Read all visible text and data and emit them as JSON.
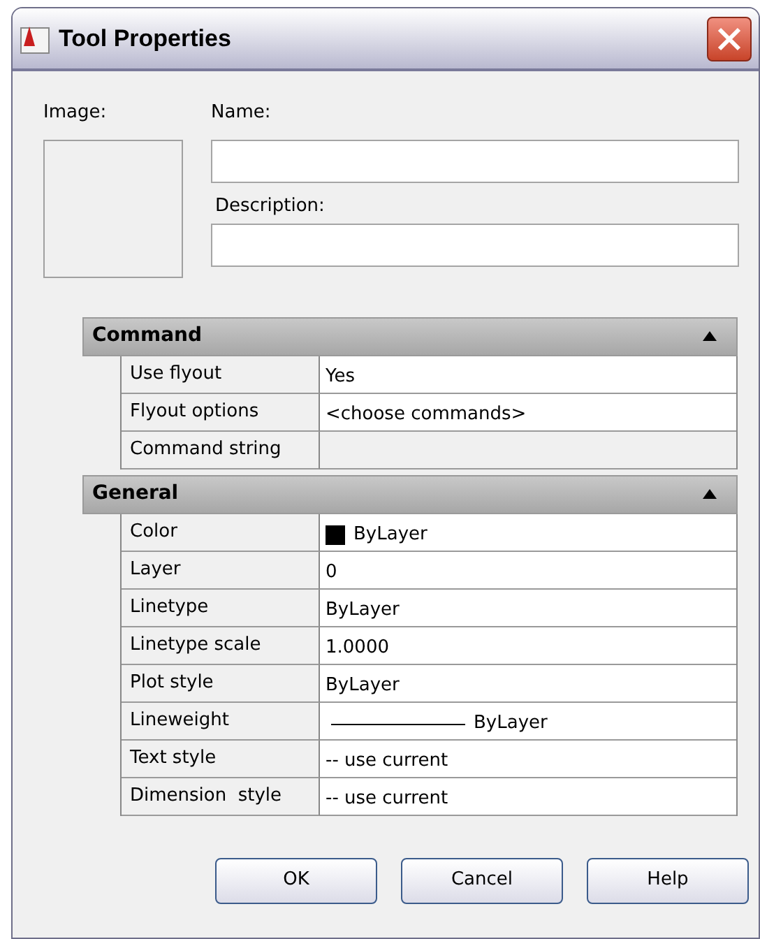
{
  "window": {
    "title": "Tool Properties"
  },
  "image": {
    "label": "Image:"
  },
  "name": {
    "label": "Name:"
  },
  "description": {
    "label": "Description:"
  },
  "sections": [
    {
      "title": "Command",
      "expanded": true,
      "rows": [
        {
          "kind": "text",
          "label": "Use flyout",
          "value": "Yes",
          "readonly": false
        },
        {
          "kind": "text",
          "label": "Flyout options",
          "value": "<choose commands>",
          "readonly": false
        },
        {
          "kind": "text",
          "label": "Command string",
          "readonly": true
        }
      ]
    },
    {
      "title": "General",
      "expanded": true,
      "rows": [
        {
          "kind": "color",
          "label": "Color",
          "value": "ByLayer",
          "color": "#000000",
          "readonly": false
        },
        {
          "kind": "text",
          "label": "Layer",
          "value": "0",
          "readonly": false
        },
        {
          "kind": "text",
          "label": "Linetype",
          "value": "ByLayer",
          "readonly": false
        },
        {
          "kind": "text",
          "label": "Linetype scale",
          "value": "1.0000",
          "readonly": false
        },
        {
          "kind": "text",
          "label": "Plot style",
          "value": "ByLayer",
          "readonly": false
        },
        {
          "kind": "lineweight",
          "label": "Lineweight",
          "value": "ByLayer",
          "readonly": false
        },
        {
          "kind": "text",
          "label": "Text style",
          "value": "-- use current",
          "readonly": false
        },
        {
          "kind": "text",
          "label": "Dimension  style",
          "value": "-- use current",
          "readonly": false
        }
      ]
    }
  ],
  "buttons": [
    "OK",
    "Cancel",
    "Help"
  ]
}
